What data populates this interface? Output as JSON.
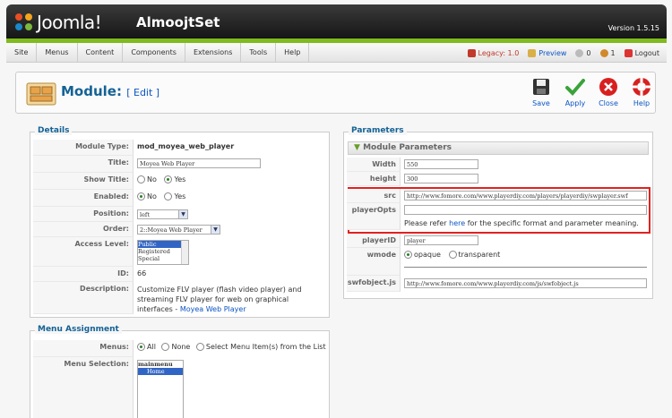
{
  "header": {
    "logo_text": "Joomla!",
    "site_name": "AlmoojtSet",
    "version": "Version 1.5.15"
  },
  "menu": {
    "items": [
      "Site",
      "Menus",
      "Content",
      "Components",
      "Extensions",
      "Tools",
      "Help"
    ]
  },
  "status": {
    "legacy": "Legacy: 1.0",
    "preview": "Preview",
    "messages": "0",
    "users": "1",
    "logout": "Logout"
  },
  "toolbar": {
    "title": "Module:",
    "title_sub": "[ Edit ]",
    "save": "Save",
    "apply": "Apply",
    "close": "Close",
    "help": "Help"
  },
  "details": {
    "legend": "Details",
    "module_type_label": "Module Type:",
    "module_type_value": "mod_moyea_web_player",
    "title_label": "Title:",
    "title_value": "Moyea Web Player",
    "show_title_label": "Show Title:",
    "no": "No",
    "yes": "Yes",
    "enabled_label": "Enabled:",
    "position_label": "Position:",
    "position_value": "left",
    "order_label": "Order:",
    "order_value": "2::Moyea Web Player",
    "access_label": "Access Level:",
    "access_options": [
      "Public",
      "Registered",
      "Special"
    ],
    "id_label": "ID:",
    "id_value": "66",
    "description_label": "Description:",
    "description_text": "Customize FLV player (flash video player) and streaming FLV player for web on graphical interfaces -",
    "description_link": "Moyea Web Player"
  },
  "menu_assignment": {
    "legend": "Menu Assignment",
    "menus_label": "Menus:",
    "all": "All",
    "none": "None",
    "select": "Select Menu Item(s) from the List",
    "menu_selection_label": "Menu Selection:",
    "menu_selection_items": [
      "mainmenu",
      "Home"
    ]
  },
  "parameters": {
    "legend": "Parameters",
    "section_title": "Module Parameters",
    "width_label": "Width",
    "width_value": "550",
    "height_label": "height",
    "height_value": "300",
    "src_label": "src",
    "src_value": "http://www.fomore.com/www.playerdiy.com/players/playerdiy/swplayer.swf",
    "playeropts_label": "playerOpts",
    "playeropts_value": "",
    "note_pre": "Please refer",
    "note_link": "here",
    "note_post": "for the specific format and parameter meaning.",
    "playerid_label": "playerID",
    "playerid_value": "player",
    "wmode_label": "wmode",
    "opaque": "opaque",
    "transparent": "transparent",
    "swfobject_label": "swfobject.js",
    "swfobject_value": "http://www.fomore.com/www.playerdiy.com/js/swfobject.js"
  },
  "colors": {
    "accent": "#146295",
    "link": "#0b55c4",
    "highlight_border": "#e02222",
    "green_bar": "#7fbb1e"
  }
}
